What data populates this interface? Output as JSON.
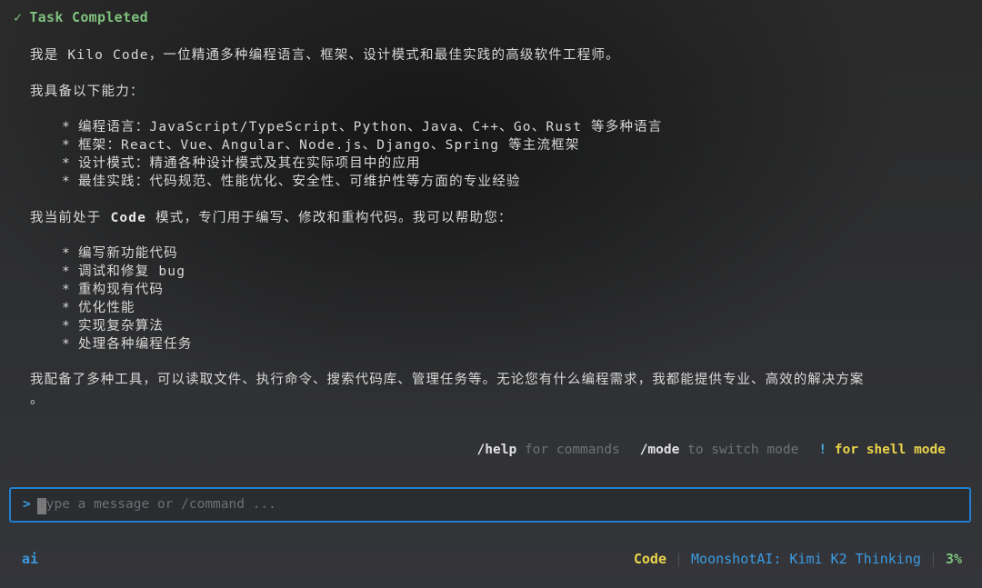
{
  "status": {
    "icon": "✓",
    "text": "Task Completed"
  },
  "message": {
    "intro": "我是 Kilo Code，一位精通多种编程语言、框架、设计模式和最佳实践的高级软件工程师。",
    "abilities_heading": "我具备以下能力：",
    "abilities": [
      "编程语言：JavaScript/TypeScript、Python、Java、C++、Go、Rust 等多种语言",
      "框架：React、Vue、Angular、Node.js、Django、Spring 等主流框架",
      "设计模式：精通各种设计模式及其在实际项目中的应用",
      "最佳实践：代码规范、性能优化、安全性、可维护性等方面的专业经验"
    ],
    "mode_pre": "我当前处于 ",
    "mode_name": "Code",
    "mode_post": " 模式，专门用于编写、修改和重构代码。我可以帮助您：",
    "help_items": [
      "编写新功能代码",
      "调试和修复 bug",
      "重构现有代码",
      "优化性能",
      "实现复杂算法",
      "处理各种编程任务"
    ],
    "closing_line1": "我配备了多种工具，可以读取文件、执行命令、搜索代码库、管理任务等。无论您有什么编程需求，我都能提供专业、高效的解决方案",
    "closing_line2": "。"
  },
  "hints": {
    "help_cmd": "/help",
    "help_desc": "for commands",
    "mode_cmd": "/mode",
    "mode_desc": "to switch mode",
    "bang": "!",
    "shell_desc": "for shell mode"
  },
  "input": {
    "prompt": ">",
    "placeholder": "Type a message or /command ..."
  },
  "footer": {
    "left_label": "ai",
    "mode": "Code",
    "separator": "|",
    "model": "MoonshotAI: Kimi K2 Thinking",
    "context_usage": "3%"
  },
  "colors": {
    "accent_blue": "#3b9be0",
    "accent_yellow": "#e9d44a",
    "success_green": "#7ec27e",
    "input_border": "#1f7fd0"
  }
}
